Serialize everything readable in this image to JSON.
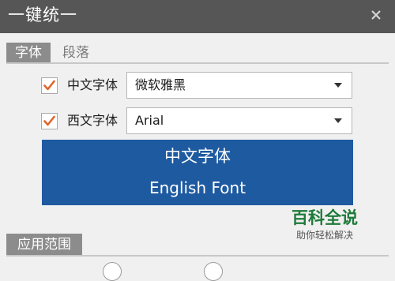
{
  "window": {
    "title": "一键统一",
    "close_icon": "close-icon"
  },
  "tabs": [
    {
      "label": "字体",
      "active": true
    },
    {
      "label": "段落",
      "active": false
    }
  ],
  "rows": [
    {
      "label": "中文字体",
      "checked": true,
      "value": "微软雅黑"
    },
    {
      "label": "西文字体",
      "checked": true,
      "value": "Arial"
    }
  ],
  "preview": {
    "cn": "中文字体",
    "en": "English Font",
    "background": "#1e5aa0"
  },
  "watermark": {
    "main": "百科全说",
    "sub": "助你轻松解决"
  },
  "section": {
    "title": "应用范围"
  },
  "colors": {
    "titlebar": "#565656",
    "check": "#e0662b",
    "tab_active": "#8c8c8c"
  }
}
